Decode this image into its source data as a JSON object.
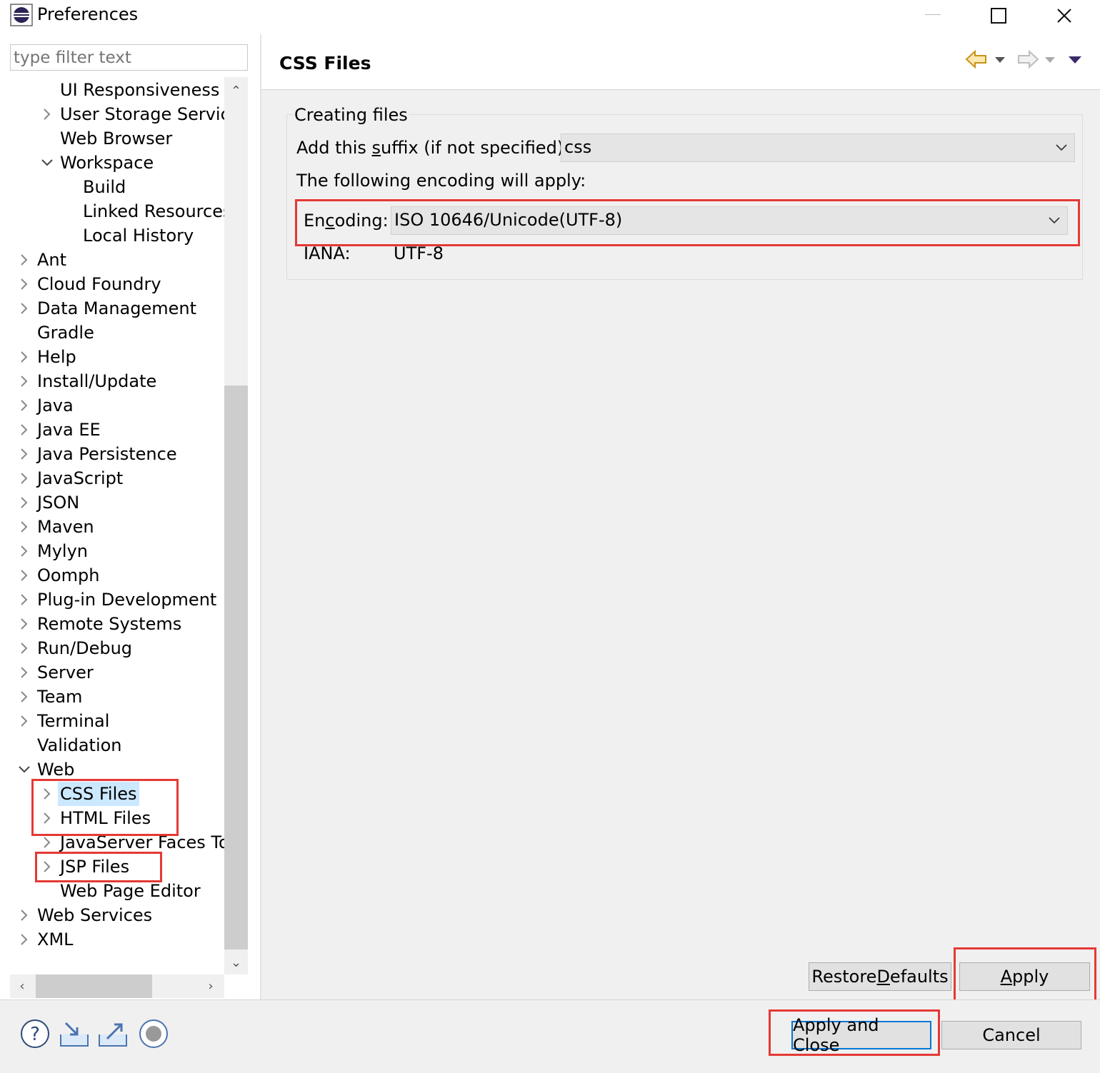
{
  "window": {
    "title": "Preferences",
    "icon": "eclipse-icon",
    "controls": [
      "minimize-icon",
      "maximize-icon",
      "close-icon"
    ]
  },
  "filter": {
    "placeholder": "type filter text",
    "value": ""
  },
  "tree": [
    {
      "label": "UI Responsiveness M",
      "depth": 2,
      "toggle": "none"
    },
    {
      "label": "User Storage Service",
      "depth": 2,
      "toggle": "collapsed"
    },
    {
      "label": "Web Browser",
      "depth": 2,
      "toggle": "none"
    },
    {
      "label": "Workspace",
      "depth": 2,
      "toggle": "expanded"
    },
    {
      "label": "Build",
      "depth": 3,
      "toggle": "none"
    },
    {
      "label": "Linked Resources",
      "depth": 3,
      "toggle": "none"
    },
    {
      "label": "Local History",
      "depth": 3,
      "toggle": "none"
    },
    {
      "label": "Ant",
      "depth": 1,
      "toggle": "collapsed"
    },
    {
      "label": "Cloud Foundry",
      "depth": 1,
      "toggle": "collapsed"
    },
    {
      "label": "Data Management",
      "depth": 1,
      "toggle": "collapsed"
    },
    {
      "label": "Gradle",
      "depth": 1,
      "toggle": "none"
    },
    {
      "label": "Help",
      "depth": 1,
      "toggle": "collapsed"
    },
    {
      "label": "Install/Update",
      "depth": 1,
      "toggle": "collapsed"
    },
    {
      "label": "Java",
      "depth": 1,
      "toggle": "collapsed"
    },
    {
      "label": "Java EE",
      "depth": 1,
      "toggle": "collapsed"
    },
    {
      "label": "Java Persistence",
      "depth": 1,
      "toggle": "collapsed"
    },
    {
      "label": "JavaScript",
      "depth": 1,
      "toggle": "collapsed"
    },
    {
      "label": "JSON",
      "depth": 1,
      "toggle": "collapsed"
    },
    {
      "label": "Maven",
      "depth": 1,
      "toggle": "collapsed"
    },
    {
      "label": "Mylyn",
      "depth": 1,
      "toggle": "collapsed"
    },
    {
      "label": "Oomph",
      "depth": 1,
      "toggle": "collapsed"
    },
    {
      "label": "Plug-in Development",
      "depth": 1,
      "toggle": "collapsed"
    },
    {
      "label": "Remote Systems",
      "depth": 1,
      "toggle": "collapsed"
    },
    {
      "label": "Run/Debug",
      "depth": 1,
      "toggle": "collapsed"
    },
    {
      "label": "Server",
      "depth": 1,
      "toggle": "collapsed"
    },
    {
      "label": "Team",
      "depth": 1,
      "toggle": "collapsed"
    },
    {
      "label": "Terminal",
      "depth": 1,
      "toggle": "collapsed"
    },
    {
      "label": "Validation",
      "depth": 1,
      "toggle": "none"
    },
    {
      "label": "Web",
      "depth": 1,
      "toggle": "expanded"
    },
    {
      "label": "CSS Files",
      "depth": 2,
      "toggle": "collapsed",
      "selected": true
    },
    {
      "label": "HTML Files",
      "depth": 2,
      "toggle": "collapsed"
    },
    {
      "label": "JavaServer Faces To",
      "depth": 2,
      "toggle": "collapsed"
    },
    {
      "label": "JSP Files",
      "depth": 2,
      "toggle": "collapsed"
    },
    {
      "label": "Web Page Editor",
      "depth": 2,
      "toggle": "none"
    },
    {
      "label": "Web Services",
      "depth": 1,
      "toggle": "collapsed"
    },
    {
      "label": "XML",
      "depth": 1,
      "toggle": "collapsed"
    }
  ],
  "page": {
    "title": "CSS Files",
    "group_label": "Creating files",
    "suffix": {
      "label_pre": "Add this ",
      "label_mn": "s",
      "label_post": "uffix (if not specified):",
      "value": "css"
    },
    "encoding_intro": "The following encoding will apply:",
    "encoding": {
      "label_pre": "En",
      "label_mn": "c",
      "label_post": "oding:",
      "value": "ISO 10646/Unicode(UTF-8)"
    },
    "iana": {
      "label": "IANA:",
      "value": "UTF-8"
    }
  },
  "buttons": {
    "restore_pre": "Restore ",
    "restore_mn": "D",
    "restore_post": "efaults",
    "apply_mn": "A",
    "apply_post": "pply",
    "apply_close": "Apply and Close",
    "cancel": "Cancel"
  },
  "toolbar_icons": [
    "back-arrow-icon",
    "back-dropdown-icon",
    "forward-arrow-icon",
    "forward-dropdown-icon",
    "view-menu-icon"
  ],
  "bottom_icons": [
    "help-icon",
    "import-icon",
    "export-icon",
    "record-icon"
  ],
  "colors": {
    "highlight_box": "#e53935",
    "selection": "#cce8ff",
    "primary_button_border": "#0078d7"
  }
}
